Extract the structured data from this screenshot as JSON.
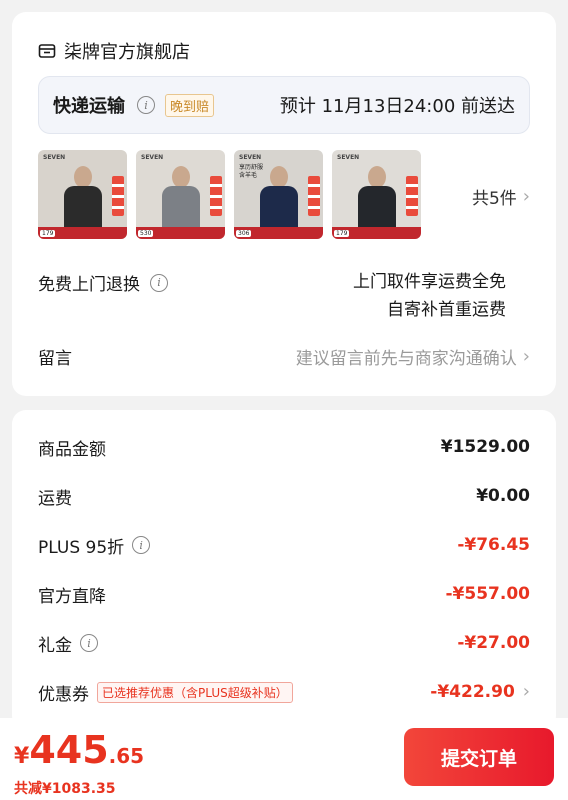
{
  "store": {
    "icon": "shop-icon",
    "name": "柒牌官方旗舰店"
  },
  "shipping": {
    "label": "快递运输",
    "late_tag": "晚到赔",
    "eta": "预计 11月13日24:00 前送达"
  },
  "products": {
    "items": [
      {
        "shirt_color": "#2b2b2b",
        "bg": "#d8d3cc",
        "price": "179"
      },
      {
        "shirt_color": "#7c8086",
        "bg": "#dedad4",
        "price": "530"
      },
      {
        "shirt_color": "#1d2a4a",
        "bg": "#d7d4cf",
        "price": "306",
        "overlay": "享历舒服 含羊毛"
      },
      {
        "shirt_color": "#24272c",
        "bg": "#dfdcd7",
        "price": "179"
      }
    ],
    "count_label": "共5件"
  },
  "return_service": {
    "label": "免费上门退换",
    "desc_line1": "上门取件享运费全免",
    "desc_line2": "自寄补首重运费"
  },
  "message": {
    "label": "留言",
    "placeholder": "建议留言前先与商家沟通确认"
  },
  "summary": {
    "goods_label": "商品金额",
    "goods_value": "¥1529.00",
    "freight_label": "运费",
    "freight_value": "¥0.00",
    "plus_label": "PLUS 95折",
    "plus_value": "-¥76.45",
    "official_label": "官方直降",
    "official_value": "-¥557.00",
    "gift_label": "礼金",
    "gift_value": "-¥27.00",
    "coupon_label": "优惠券",
    "coupon_tag": "已选推荐优惠（含PLUS超级补贴）",
    "coupon_value": "-¥422.90"
  },
  "footer": {
    "currency": "¥",
    "total_int": "445",
    "total_dec": ".65",
    "saved": "共减¥1083.35",
    "submit_label": "提交订单"
  },
  "colors": {
    "accent_red": "#e8331f",
    "page_bg": "#f2f2f2"
  }
}
